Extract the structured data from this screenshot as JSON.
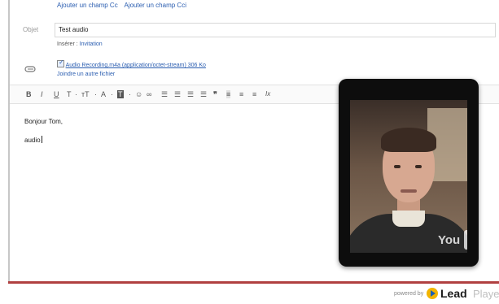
{
  "cc_links": [
    "Ajouter un champ Cc",
    "Ajouter un champ Cci"
  ],
  "subject": {
    "label": "Objet",
    "value": "Test audio"
  },
  "insert": {
    "label": "Insérer :",
    "link": "Invitation"
  },
  "attachment": {
    "file": "Audio Recording.m4a (application/octet-stream) 306 Ko",
    "add_link": "Joindre un autre fichier"
  },
  "toolbar": [
    "B",
    "I",
    "U",
    "T",
    "·",
    "тT",
    "·",
    "A",
    "·",
    "T",
    "·",
    "☺",
    "∞",
    "☰",
    "☰",
    "☰",
    "☰",
    "❞",
    "≡",
    "≡",
    "≡",
    "Ix"
  ],
  "body": {
    "line1": "Bonjour Tom,",
    "line2": "audio"
  },
  "video": {
    "watermark": "You"
  },
  "footer": {
    "powered": "powered by",
    "brand_main": "Lead",
    "brand_rest": "Playe"
  },
  "colors": {
    "link": "#2a5db0",
    "accent_bar": "#b04040",
    "lead_icon": "#f2b400"
  }
}
